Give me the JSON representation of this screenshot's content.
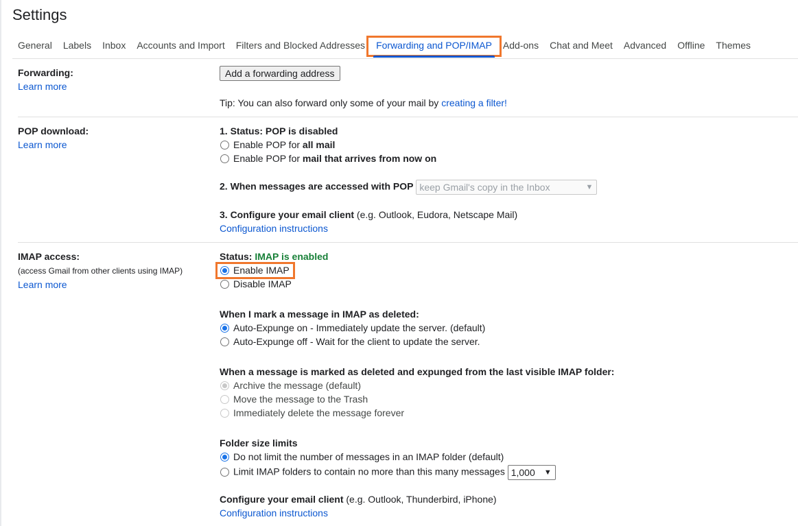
{
  "page_title": "Settings",
  "tabs": [
    "General",
    "Labels",
    "Inbox",
    "Accounts and Import",
    "Filters and Blocked Addresses",
    "Forwarding and POP/IMAP",
    "Add-ons",
    "Chat and Meet",
    "Advanced",
    "Offline",
    "Themes"
  ],
  "forwarding": {
    "label": "Forwarding:",
    "learn_more": "Learn more",
    "button": "Add a forwarding address",
    "tip": "Tip: You can also forward only some of your mail by ",
    "tip_link": "creating a filter!"
  },
  "pop": {
    "label": "POP download:",
    "learn_more": "Learn more",
    "status": "1. Status: POP is disabled",
    "opt1_prefix": "Enable POP for ",
    "opt1_bold": "all mail",
    "opt2_prefix": "Enable POP for ",
    "opt2_bold": "mail that arrives from now on",
    "when_label": "2. When messages are accessed with POP",
    "when_select": "keep Gmail's copy in the Inbox",
    "config_label": "3. Configure your email client",
    "config_hint": " (e.g. Outlook, Eudora, Netscape Mail)",
    "config_link": "Configuration instructions"
  },
  "imap": {
    "label": "IMAP access:",
    "sublabel": "(access Gmail from other clients using IMAP)",
    "learn_more": "Learn more",
    "status_prefix": "Status: ",
    "status_value": "IMAP is enabled",
    "enable": "Enable IMAP",
    "disable": "Disable IMAP",
    "deleted_heading": "When I mark a message in IMAP as deleted:",
    "expunge_on": "Auto-Expunge on - Immediately update the server. (default)",
    "expunge_off": "Auto-Expunge off - Wait for the client to update the server.",
    "expunged_heading": "When a message is marked as deleted and expunged from the last visible IMAP folder:",
    "archive": "Archive the message (default)",
    "trash": "Move the message to the Trash",
    "delete_forever": "Immediately delete the message forever",
    "folder_heading": "Folder size limits",
    "no_limit": "Do not limit the number of messages in an IMAP folder (default)",
    "limit": "Limit IMAP folders to contain no more than this many messages",
    "limit_value": "1,000",
    "config_label": "Configure your email client",
    "config_hint": " (e.g. Outlook, Thunderbird, iPhone)",
    "config_link": "Configuration instructions"
  },
  "colors": {
    "accent": "#0b57d0",
    "highlight": "#f0772d",
    "status_green": "#188038"
  }
}
